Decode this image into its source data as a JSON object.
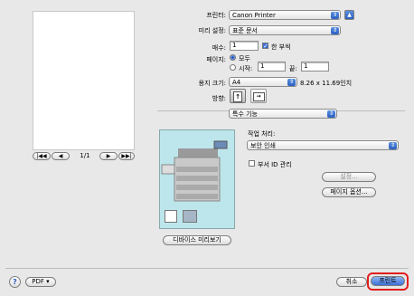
{
  "printer": {
    "label": "프린터:",
    "value": "Canon Printer"
  },
  "presets": {
    "label": "미리 설정:",
    "value": "표준 문서"
  },
  "copies": {
    "label": "매수:",
    "value": "1",
    "collate_label": "한 부씩"
  },
  "pages": {
    "label": "페이지:",
    "all_label": "모두",
    "from_label": "시작:",
    "from_value": "1",
    "to_label": "끝:",
    "to_value": "1"
  },
  "paper_size": {
    "label": "용지 크기:",
    "value": "A4",
    "dims": "8.26 x 11.69인치"
  },
  "orientation": {
    "label": "방향:"
  },
  "pane": {
    "value": "특수 기능"
  },
  "job": {
    "label": "작업 처리:",
    "value": "보안 인쇄",
    "dept_id_label": "부서 ID 관리",
    "settings_button": "설정...",
    "page_options_button": "페이지 옵션..."
  },
  "preview": {
    "page_indicator": "1/1",
    "device_preview_button": "디바이스 미리보기"
  },
  "footer": {
    "help": "?",
    "pdf_button": "PDF ▾",
    "cancel_button": "취소",
    "print_button": "프린트"
  },
  "colors": {
    "accent": "#3b6fd6",
    "highlight": "#e11d1d",
    "preview_bg": "#bde6ec"
  }
}
